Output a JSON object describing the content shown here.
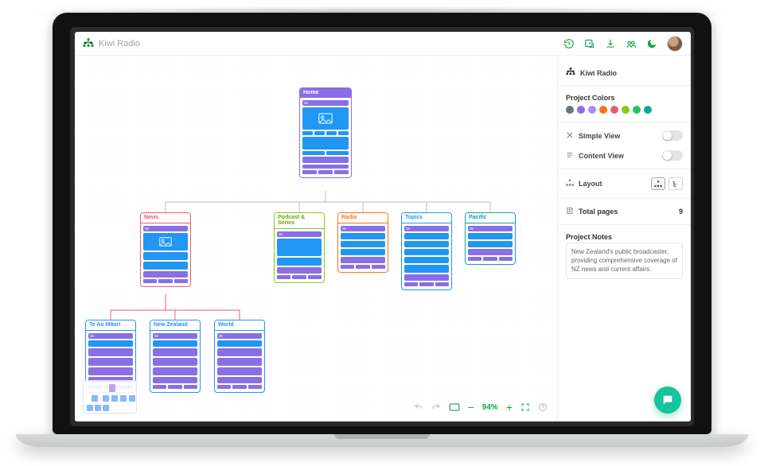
{
  "app_title": "Kiwi Radio",
  "project_name": "Kiwi Radio",
  "panel": {
    "colors_label": "Project Colors",
    "colors": [
      "#6b7280",
      "#8a6ee6",
      "#a78bfa",
      "#f97316",
      "#e85d75",
      "#84cc16",
      "#22c55e",
      "#0ea5a0"
    ],
    "simple_view_label": "Simple View",
    "content_view_label": "Content View",
    "layout_label": "Layout",
    "total_pages_label": "Total pages",
    "total_pages_value": "9",
    "notes_label": "Project Notes",
    "notes_text": "New Zealand's public broadcaster, providing comprehensive coverage of NZ news and current affairs."
  },
  "zoom_level": "94%",
  "nodes": {
    "home": {
      "label": "Home",
      "color": "#8a6ee6"
    },
    "news": {
      "label": "News",
      "color": "#e85d75"
    },
    "podcasts": {
      "label": "Podcast & Series",
      "color": "#84cc16"
    },
    "radio": {
      "label": "Radio",
      "color": "#f97316"
    },
    "topics": {
      "label": "Topics",
      "color": "#2196f3"
    },
    "pacific": {
      "label": "Pacific",
      "color": "#0ea5a0"
    },
    "teao": {
      "label": "Te Ao Māori",
      "color": "#2196f3"
    },
    "nz": {
      "label": "New Zealand",
      "color": "#2196f3"
    },
    "world": {
      "label": "World",
      "color": "#2196f3"
    }
  }
}
